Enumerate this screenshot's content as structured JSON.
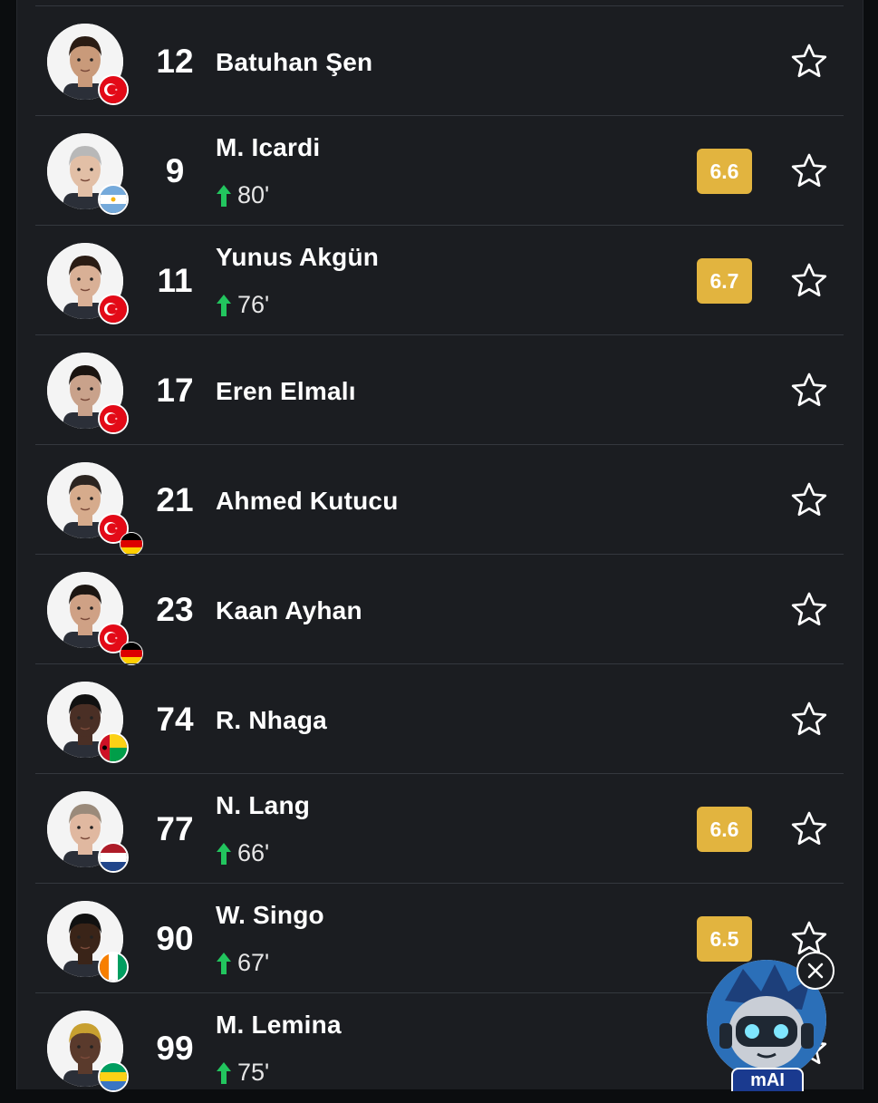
{
  "players": [
    {
      "shirt": "12",
      "name": "Batuhan Şen",
      "flags": [
        "turkey"
      ],
      "sub_minute": "",
      "rating": ""
    },
    {
      "shirt": "9",
      "name": "M. Icardi",
      "flags": [
        "argentina"
      ],
      "sub_minute": "80'",
      "rating": "6.6"
    },
    {
      "shirt": "11",
      "name": "Yunus Akgün",
      "flags": [
        "turkey"
      ],
      "sub_minute": "76'",
      "rating": "6.7"
    },
    {
      "shirt": "17",
      "name": "Eren Elmalı",
      "flags": [
        "turkey"
      ],
      "sub_minute": "",
      "rating": ""
    },
    {
      "shirt": "21",
      "name": "Ahmed Kutucu",
      "flags": [
        "turkey",
        "germany"
      ],
      "sub_minute": "",
      "rating": ""
    },
    {
      "shirt": "23",
      "name": "Kaan Ayhan",
      "flags": [
        "turkey",
        "germany"
      ],
      "sub_minute": "",
      "rating": ""
    },
    {
      "shirt": "74",
      "name": "R. Nhaga",
      "flags": [
        "guinea-bissau"
      ],
      "sub_minute": "",
      "rating": ""
    },
    {
      "shirt": "77",
      "name": "N. Lang",
      "flags": [
        "netherlands"
      ],
      "sub_minute": "66'",
      "rating": "6.6"
    },
    {
      "shirt": "90",
      "name": "W. Singo",
      "flags": [
        "ivory-coast"
      ],
      "sub_minute": "67'",
      "rating": "6.5"
    },
    {
      "shirt": "99",
      "name": "M. Lemina",
      "flags": [
        "gabon"
      ],
      "sub_minute": "75'",
      "rating": ""
    }
  ],
  "icons": {
    "favorite": "star-outline-icon",
    "substitution": "arrow-up-icon",
    "close": "close-icon"
  },
  "assistant": {
    "label": "mAI"
  },
  "colors": {
    "background": "#1b1d21",
    "rating_badge": "#e2b43f",
    "sub_arrow": "#22c55e",
    "divider": "#34383e"
  }
}
